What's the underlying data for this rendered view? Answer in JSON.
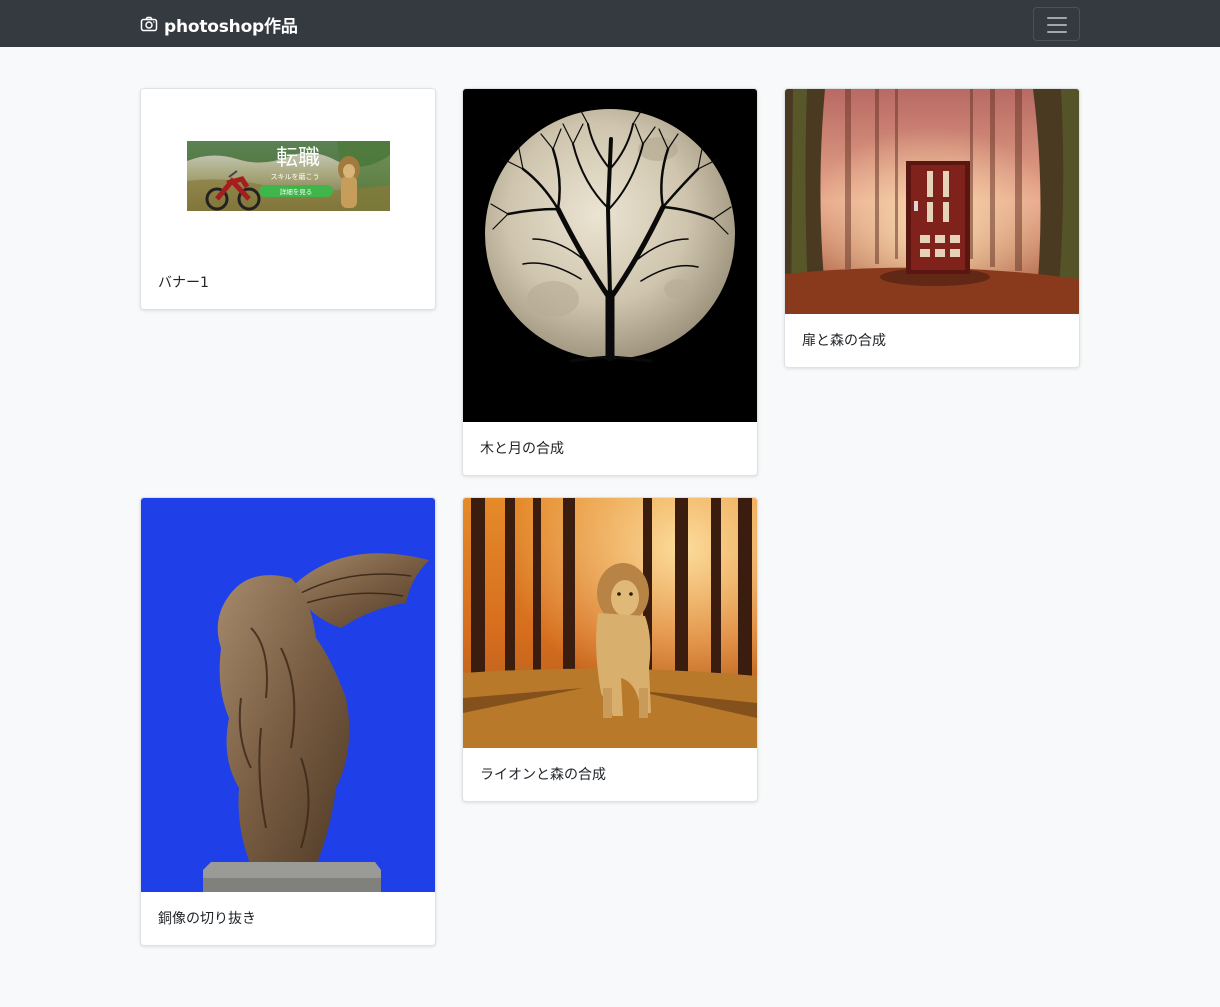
{
  "navbar": {
    "brand_icon": "camera-icon",
    "brand_text": "photoshop作品",
    "toggler_icon": "hamburger-menu-icon",
    "background_color": "#343a40"
  },
  "banner": {
    "headline": "転職",
    "subtext": "スキルを磨こう",
    "button_label": "詳細を見る"
  },
  "cards": [
    {
      "title": "バナー1",
      "image": "banner-image"
    },
    {
      "title": "木と月の合成",
      "image": "tree-moon-image"
    },
    {
      "title": "扉と森の合成",
      "image": "door-forest-image"
    },
    {
      "title": "銅像の切り抜き",
      "image": "statue-cutout-image"
    },
    {
      "title": "ライオンと森の合成",
      "image": "lion-forest-image"
    }
  ]
}
